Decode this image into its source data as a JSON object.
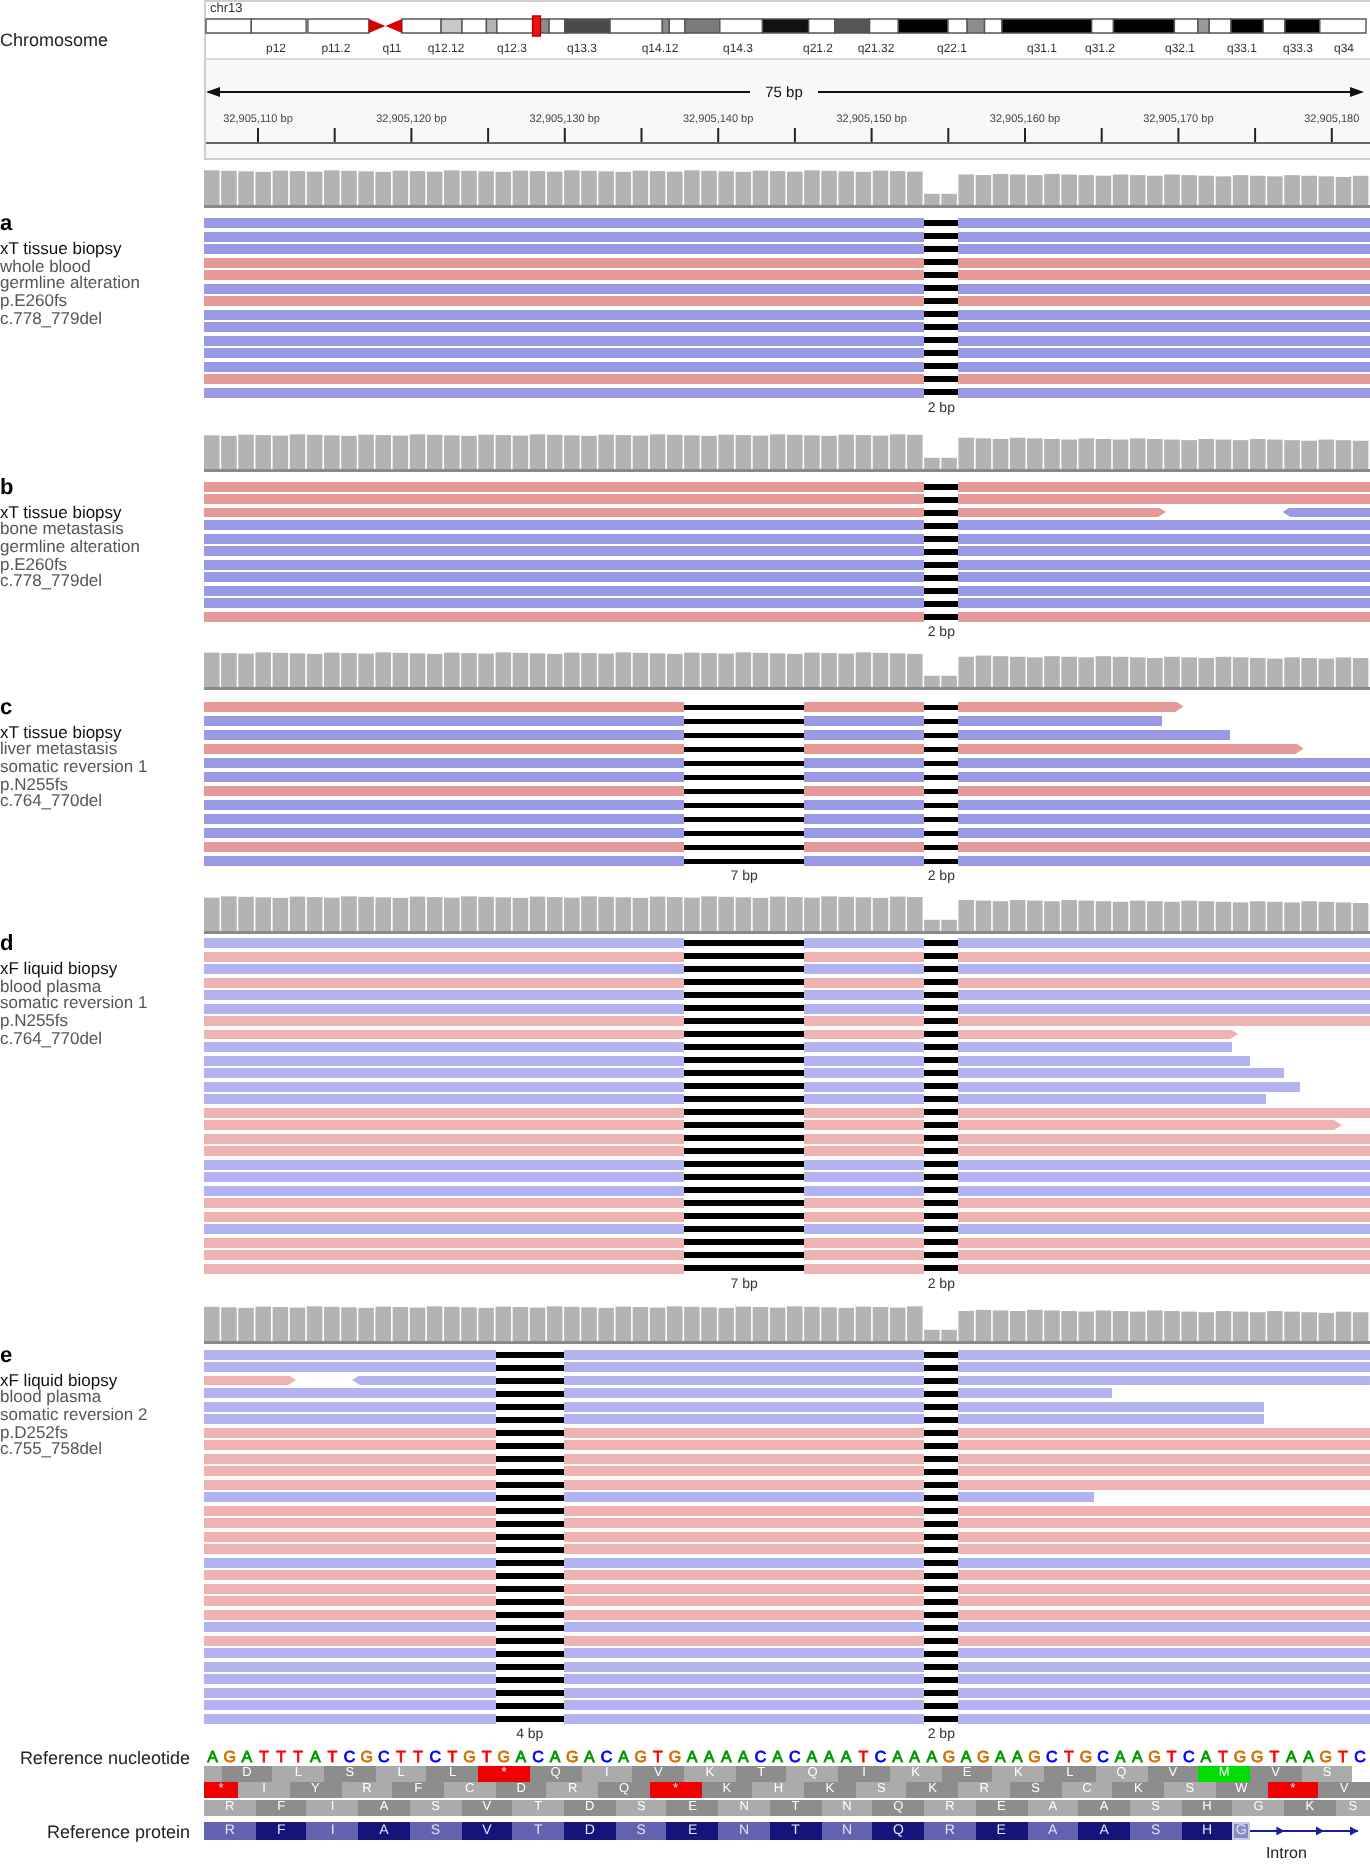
{
  "chromosome_track": {
    "label": "Chromosome",
    "chromosome": "chr13",
    "band_labels": [
      "p12",
      "p11.2",
      "q11",
      "q12.12",
      "q12.3",
      "q13.3",
      "q14.12",
      "q14.3",
      "q21.2",
      "q21.32",
      "q22.1",
      "q31.1",
      "q31.2",
      "q32.1",
      "q33.1",
      "q33.3",
      "q34"
    ],
    "span": "75 bp",
    "ruler_labels": [
      "32,905,110 bp",
      "32,905,120 bp",
      "32,905,130 bp",
      "32,905,140 bp",
      "32,905,150 bp",
      "32,905,160 bp",
      "32,905,170 bp",
      "32,905,180"
    ]
  },
  "panels": [
    {
      "letter": "a",
      "sample": "xT tissue biopsy",
      "details": [
        "whole blood",
        "germline alteration",
        "p.E260fs",
        "c.778_779del"
      ],
      "deletions": [
        {
          "label": "2 bp"
        }
      ],
      "reads": [
        {
          "kind": "full",
          "color": "#9999e6"
        },
        {
          "kind": "full",
          "color": "#9999e6"
        },
        {
          "kind": "full",
          "color": "#9999e6"
        },
        {
          "kind": "full",
          "color": "#e69999"
        },
        {
          "kind": "full",
          "color": "#e69999"
        },
        {
          "kind": "full",
          "color": "#9999e6"
        },
        {
          "kind": "full",
          "color": "#e69999"
        },
        {
          "kind": "full",
          "color": "#9999e6"
        },
        {
          "kind": "full",
          "color": "#9999e6"
        },
        {
          "kind": "full",
          "color": "#9999e6"
        },
        {
          "kind": "full",
          "color": "#9999e6"
        },
        {
          "kind": "full",
          "color": "#9999e6"
        },
        {
          "kind": "full",
          "color": "#e69999"
        },
        {
          "kind": "full",
          "color": "#9999e6"
        }
      ]
    },
    {
      "letter": "b",
      "sample": "xT tissue biopsy",
      "details": [
        "bone metastasis",
        "germline alteration",
        "p.E260fs",
        "c.778_779del"
      ],
      "deletions": [
        {
          "label": "2 bp"
        }
      ],
      "reads": [
        {
          "kind": "full",
          "color": "#e69999"
        },
        {
          "kind": "full",
          "color": "#e69999"
        },
        {
          "kind": "split",
          "color": "#e69999",
          "mate": {
            "color": "#9999e6"
          }
        },
        {
          "kind": "full",
          "color": "#9999e6"
        },
        {
          "kind": "full",
          "color": "#9999e6"
        },
        {
          "kind": "full",
          "color": "#9999e6"
        },
        {
          "kind": "full",
          "color": "#9999e6"
        },
        {
          "kind": "full",
          "color": "#9999e6"
        },
        {
          "kind": "full",
          "color": "#9999e6"
        },
        {
          "kind": "full",
          "color": "#9999e6"
        },
        {
          "kind": "full",
          "color": "#e69999"
        }
      ]
    },
    {
      "letter": "c",
      "sample": "xT tissue biopsy",
      "details": [
        "liver metastasis",
        "somatic reversion 1",
        "p.N255fs",
        "c.764_770del"
      ],
      "deletions": [
        {
          "label": "7 bp"
        },
        {
          "label": "2 bp"
        }
      ],
      "reads": [
        {
          "kind": "ends_early_arrow",
          "color": "#e69999"
        },
        {
          "kind": "ends_early",
          "color": "#9999e6"
        },
        {
          "kind": "ends_early",
          "color": "#9999e6"
        },
        {
          "kind": "ends_early_arrow",
          "color": "#e69999"
        },
        {
          "kind": "full",
          "color": "#9999e6"
        },
        {
          "kind": "full",
          "color": "#9999e6"
        },
        {
          "kind": "full",
          "color": "#e69999"
        },
        {
          "kind": "full",
          "color": "#9999e6"
        },
        {
          "kind": "full",
          "color": "#9999e6"
        },
        {
          "kind": "full",
          "color": "#9999e6"
        },
        {
          "kind": "full",
          "color": "#e69999"
        },
        {
          "kind": "full",
          "color": "#9999e6"
        }
      ]
    },
    {
      "letter": "d",
      "sample": "xF liquid biopsy",
      "details": [
        "blood plasma",
        "somatic reversion 1",
        "p.N255fs",
        "c.764_770del"
      ],
      "deletions": [
        {
          "label": "7 bp"
        },
        {
          "label": "2 bp"
        }
      ],
      "reads": [
        {
          "kind": "full",
          "color": "#b3b3ef"
        },
        {
          "kind": "full",
          "color": "#efb3b3"
        },
        {
          "kind": "full",
          "color": "#b3b3ef"
        },
        {
          "kind": "full",
          "color": "#efb3b3"
        },
        {
          "kind": "full",
          "color": "#b3b3ef"
        },
        {
          "kind": "full",
          "color": "#b3b3ef"
        },
        {
          "kind": "full",
          "color": "#efb3b3"
        },
        {
          "kind": "ends_early_arrow",
          "color": "#efb3b3"
        },
        {
          "kind": "ends_early",
          "color": "#b3b3ef"
        },
        {
          "kind": "ends_early",
          "color": "#b3b3ef"
        },
        {
          "kind": "ends_early",
          "color": "#b3b3ef"
        },
        {
          "kind": "ends_early",
          "color": "#b3b3ef"
        },
        {
          "kind": "ends_early",
          "color": "#b3b3ef"
        },
        {
          "kind": "full",
          "color": "#efb3b3"
        },
        {
          "kind": "ends_early_arrow",
          "color": "#efb3b3"
        },
        {
          "kind": "full",
          "color": "#efb3b3"
        },
        {
          "kind": "full",
          "color": "#efb3b3"
        },
        {
          "kind": "full",
          "color": "#b3b3ef"
        },
        {
          "kind": "full",
          "color": "#b3b3ef"
        },
        {
          "kind": "full",
          "color": "#b3b3ef"
        },
        {
          "kind": "full",
          "color": "#efb3b3"
        },
        {
          "kind": "full",
          "color": "#efb3b3"
        },
        {
          "kind": "full",
          "color": "#b3b3ef"
        },
        {
          "kind": "full",
          "color": "#efb3b3"
        },
        {
          "kind": "full",
          "color": "#efb3b3"
        },
        {
          "kind": "full",
          "color": "#efb3b3"
        }
      ]
    },
    {
      "letter": "e",
      "sample": "xF liquid biopsy",
      "details": [
        "blood plasma",
        "somatic reversion 2",
        "p.D252fs",
        "c.755_758del"
      ],
      "deletions": [
        {
          "label": "4 bp"
        },
        {
          "label": "2 bp"
        }
      ],
      "reads": [
        {
          "kind": "full",
          "color": "#b3b3ef"
        },
        {
          "kind": "full",
          "color": "#b3b3ef"
        },
        {
          "kind": "split",
          "color": "#efb3b3",
          "mate": {
            "color": "#b3b3ef"
          }
        },
        {
          "kind": "ends_early",
          "color": "#b3b3ef"
        },
        {
          "kind": "ends_early",
          "color": "#b3b3ef"
        },
        {
          "kind": "ends_early",
          "color": "#b3b3ef"
        },
        {
          "kind": "full",
          "color": "#efb3b3"
        },
        {
          "kind": "full",
          "color": "#efb3b3"
        },
        {
          "kind": "full",
          "color": "#efb3b3"
        },
        {
          "kind": "full",
          "color": "#efb3b3"
        },
        {
          "kind": "full",
          "color": "#efb3b3"
        },
        {
          "kind": "ends_early",
          "color": "#b3b3ef"
        },
        {
          "kind": "full",
          "color": "#efb3b3"
        },
        {
          "kind": "full",
          "color": "#efb3b3"
        },
        {
          "kind": "full",
          "color": "#efb3b3"
        },
        {
          "kind": "full",
          "color": "#efb3b3"
        },
        {
          "kind": "full",
          "color": "#b3b3ef"
        },
        {
          "kind": "full",
          "color": "#efb3b3"
        },
        {
          "kind": "full",
          "color": "#efb3b3"
        },
        {
          "kind": "full",
          "color": "#efb3b3"
        },
        {
          "kind": "full",
          "color": "#efb3b3"
        },
        {
          "kind": "full",
          "color": "#b3b3ef"
        },
        {
          "kind": "full",
          "color": "#efb3b3"
        },
        {
          "kind": "full",
          "color": "#b3b3ef"
        },
        {
          "kind": "full",
          "color": "#b3b3ef"
        },
        {
          "kind": "full",
          "color": "#b3b3ef"
        },
        {
          "kind": "full",
          "color": "#b3b3ef"
        },
        {
          "kind": "full",
          "color": "#b3b3ef"
        },
        {
          "kind": "full",
          "color": "#b3b3ef"
        }
      ]
    }
  ],
  "reference_nucleotide": {
    "label": "Reference nucleotide",
    "bases": [
      {
        "base": "A",
        "color": "#009600"
      },
      {
        "base": "G",
        "color": "#d17105"
      },
      {
        "base": "A",
        "color": "#009600"
      },
      {
        "base": "T",
        "color": "#ff0000"
      },
      {
        "base": "T",
        "color": "#ff0000"
      },
      {
        "base": "T",
        "color": "#ff0000"
      },
      {
        "base": "A",
        "color": "#009600"
      },
      {
        "base": "T",
        "color": "#ff0000"
      },
      {
        "base": "C",
        "color": "#0000ff"
      },
      {
        "base": "G",
        "color": "#d17105"
      },
      {
        "base": "C",
        "color": "#0000ff"
      },
      {
        "base": "T",
        "color": "#ff0000"
      },
      {
        "base": "T",
        "color": "#ff0000"
      },
      {
        "base": "C",
        "color": "#0000ff"
      },
      {
        "base": "T",
        "color": "#ff0000"
      },
      {
        "base": "G",
        "color": "#d17105"
      },
      {
        "base": "T",
        "color": "#ff0000"
      },
      {
        "base": "G",
        "color": "#d17105"
      },
      {
        "base": "A",
        "color": "#009600"
      },
      {
        "base": "C",
        "color": "#0000ff"
      },
      {
        "base": "A",
        "color": "#009600"
      },
      {
        "base": "G",
        "color": "#d17105"
      },
      {
        "base": "A",
        "color": "#009600"
      },
      {
        "base": "C",
        "color": "#0000ff"
      },
      {
        "base": "A",
        "color": "#009600"
      },
      {
        "base": "G",
        "color": "#d17105"
      },
      {
        "base": "T",
        "color": "#ff0000"
      },
      {
        "base": "G",
        "color": "#d17105"
      },
      {
        "base": "A",
        "color": "#009600"
      },
      {
        "base": "A",
        "color": "#009600"
      },
      {
        "base": "A",
        "color": "#009600"
      },
      {
        "base": "A",
        "color": "#009600"
      },
      {
        "base": "C",
        "color": "#0000ff"
      },
      {
        "base": "A",
        "color": "#009600"
      },
      {
        "base": "C",
        "color": "#0000ff"
      },
      {
        "base": "A",
        "color": "#009600"
      },
      {
        "base": "A",
        "color": "#009600"
      },
      {
        "base": "A",
        "color": "#009600"
      },
      {
        "base": "T",
        "color": "#ff0000"
      },
      {
        "base": "C",
        "color": "#0000ff"
      },
      {
        "base": "A",
        "color": "#009600"
      },
      {
        "base": "A",
        "color": "#009600"
      },
      {
        "base": "A",
        "color": "#009600"
      },
      {
        "base": "G",
        "color": "#d17105"
      },
      {
        "base": "A",
        "color": "#009600"
      },
      {
        "base": "G",
        "color": "#d17105"
      },
      {
        "base": "A",
        "color": "#009600"
      },
      {
        "base": "A",
        "color": "#009600"
      },
      {
        "base": "G",
        "color": "#d17105"
      },
      {
        "base": "C",
        "color": "#0000ff"
      },
      {
        "base": "T",
        "color": "#ff0000"
      },
      {
        "base": "G",
        "color": "#d17105"
      },
      {
        "base": "C",
        "color": "#0000ff"
      },
      {
        "base": "A",
        "color": "#009600"
      },
      {
        "base": "A",
        "color": "#009600"
      },
      {
        "base": "G",
        "color": "#d17105"
      },
      {
        "base": "T",
        "color": "#ff0000"
      },
      {
        "base": "C",
        "color": "#0000ff"
      },
      {
        "base": "A",
        "color": "#009600"
      },
      {
        "base": "T",
        "color": "#ff0000"
      },
      {
        "base": "G",
        "color": "#d17105"
      },
      {
        "base": "G",
        "color": "#d17105"
      },
      {
        "base": "T",
        "color": "#ff0000"
      },
      {
        "base": "A",
        "color": "#009600"
      },
      {
        "base": "A",
        "color": "#009600"
      },
      {
        "base": "G",
        "color": "#d17105"
      },
      {
        "base": "T",
        "color": "#ff0000"
      },
      {
        "base": "C",
        "color": "#0000ff"
      }
    ]
  },
  "translation_frames": [
    {
      "codons": [
        {
          "aa": "D",
          "kind": "amino_acid"
        },
        {
          "aa": "L",
          "kind": "amino_acid"
        },
        {
          "aa": "S",
          "kind": "amino_acid"
        },
        {
          "aa": "L",
          "kind": "amino_acid"
        },
        {
          "aa": "L",
          "kind": "amino_acid"
        },
        {
          "aa": "*",
          "kind": "stop"
        },
        {
          "aa": "Q",
          "kind": "amino_acid"
        },
        {
          "aa": "I",
          "kind": "amino_acid"
        },
        {
          "aa": "V",
          "kind": "amino_acid"
        },
        {
          "aa": "K",
          "kind": "amino_acid"
        },
        {
          "aa": "T",
          "kind": "amino_acid"
        },
        {
          "aa": "Q",
          "kind": "amino_acid"
        },
        {
          "aa": "I",
          "kind": "amino_acid"
        },
        {
          "aa": "K",
          "kind": "amino_acid"
        },
        {
          "aa": "E",
          "kind": "amino_acid"
        },
        {
          "aa": "K",
          "kind": "amino_acid"
        },
        {
          "aa": "L",
          "kind": "amino_acid"
        },
        {
          "aa": "Q",
          "kind": "amino_acid"
        },
        {
          "aa": "V",
          "kind": "amino_acid"
        },
        {
          "aa": "M",
          "kind": "start"
        },
        {
          "aa": "V",
          "kind": "amino_acid"
        },
        {
          "aa": "S",
          "kind": "amino_acid"
        }
      ]
    },
    {
      "codons": [
        {
          "aa": "*",
          "kind": "stop"
        },
        {
          "aa": "I",
          "kind": "amino_acid"
        },
        {
          "aa": "Y",
          "kind": "amino_acid"
        },
        {
          "aa": "R",
          "kind": "amino_acid"
        },
        {
          "aa": "F",
          "kind": "amino_acid"
        },
        {
          "aa": "C",
          "kind": "amino_acid"
        },
        {
          "aa": "D",
          "kind": "amino_acid"
        },
        {
          "aa": "R",
          "kind": "amino_acid"
        },
        {
          "aa": "Q",
          "kind": "amino_acid"
        },
        {
          "aa": "*",
          "kind": "stop"
        },
        {
          "aa": "K",
          "kind": "amino_acid"
        },
        {
          "aa": "H",
          "kind": "amino_acid"
        },
        {
          "aa": "K",
          "kind": "amino_acid"
        },
        {
          "aa": "S",
          "kind": "amino_acid"
        },
        {
          "aa": "K",
          "kind": "amino_acid"
        },
        {
          "aa": "R",
          "kind": "amino_acid"
        },
        {
          "aa": "S",
          "kind": "amino_acid"
        },
        {
          "aa": "C",
          "kind": "amino_acid"
        },
        {
          "aa": "K",
          "kind": "amino_acid"
        },
        {
          "aa": "S",
          "kind": "amino_acid"
        },
        {
          "aa": "W",
          "kind": "amino_acid"
        },
        {
          "aa": "*",
          "kind": "stop"
        },
        {
          "aa": "V",
          "kind": "amino_acid"
        }
      ]
    },
    {
      "codons": [
        {
          "aa": "R",
          "kind": "amino_acid"
        },
        {
          "aa": "F",
          "kind": "amino_acid"
        },
        {
          "aa": "I",
          "kind": "amino_acid"
        },
        {
          "aa": "A",
          "kind": "amino_acid"
        },
        {
          "aa": "S",
          "kind": "amino_acid"
        },
        {
          "aa": "V",
          "kind": "amino_acid"
        },
        {
          "aa": "T",
          "kind": "amino_acid"
        },
        {
          "aa": "D",
          "kind": "amino_acid"
        },
        {
          "aa": "S",
          "kind": "amino_acid"
        },
        {
          "aa": "E",
          "kind": "amino_acid"
        },
        {
          "aa": "N",
          "kind": "amino_acid"
        },
        {
          "aa": "T",
          "kind": "amino_acid"
        },
        {
          "aa": "N",
          "kind": "amino_acid"
        },
        {
          "aa": "Q",
          "kind": "amino_acid"
        },
        {
          "aa": "R",
          "kind": "amino_acid"
        },
        {
          "aa": "E",
          "kind": "amino_acid"
        },
        {
          "aa": "A",
          "kind": "amino_acid"
        },
        {
          "aa": "A",
          "kind": "amino_acid"
        },
        {
          "aa": "S",
          "kind": "amino_acid"
        },
        {
          "aa": "H",
          "kind": "amino_acid"
        },
        {
          "aa": "G",
          "kind": "amino_acid"
        },
        {
          "aa": "K",
          "kind": "amino_acid"
        },
        {
          "aa": "S",
          "kind": "amino_acid"
        }
      ]
    }
  ],
  "reference_protein": {
    "label": "Reference protein",
    "residues": [
      {
        "aa": "R",
        "kind": "exon"
      },
      {
        "aa": "F",
        "kind": "exon"
      },
      {
        "aa": "I",
        "kind": "exon"
      },
      {
        "aa": "A",
        "kind": "exon"
      },
      {
        "aa": "S",
        "kind": "exon"
      },
      {
        "aa": "V",
        "kind": "exon"
      },
      {
        "aa": "T",
        "kind": "exon"
      },
      {
        "aa": "D",
        "kind": "exon"
      },
      {
        "aa": "S",
        "kind": "exon"
      },
      {
        "aa": "E",
        "kind": "exon"
      },
      {
        "aa": "N",
        "kind": "exon"
      },
      {
        "aa": "T",
        "kind": "exon"
      },
      {
        "aa": "N",
        "kind": "exon"
      },
      {
        "aa": "Q",
        "kind": "exon"
      },
      {
        "aa": "R",
        "kind": "exon"
      },
      {
        "aa": "E",
        "kind": "exon"
      },
      {
        "aa": "A",
        "kind": "exon"
      },
      {
        "aa": "A",
        "kind": "exon"
      },
      {
        "aa": "S",
        "kind": "exon"
      },
      {
        "aa": "H",
        "kind": "exon"
      },
      {
        "aa": "G",
        "kind": "exon_end"
      }
    ],
    "intron_label": "Intron"
  }
}
